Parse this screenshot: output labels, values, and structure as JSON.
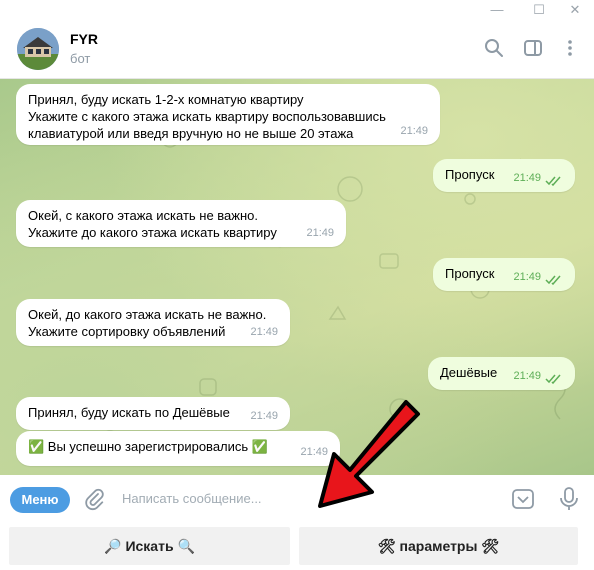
{
  "header": {
    "title": "FYR",
    "subtitle": "бот"
  },
  "messages": [
    {
      "side": "in",
      "text1": "Принял, буду искать 1-2-х комнатую квартиру",
      "text2": "Укажите с какого этажа искать квартиру воспользовавшись",
      "text3": "клавиатурой или введя вручную но не выше 20 этажа",
      "time": "21:49"
    },
    {
      "side": "out",
      "text": "Пропуск",
      "time": "21:49"
    },
    {
      "side": "in",
      "text1": "Окей, с какого этажа искать не важно.",
      "text2": "Укажите до какого этажа искать квартиру",
      "time": "21:49"
    },
    {
      "side": "out",
      "text": "Пропуск",
      "time": "21:49"
    },
    {
      "side": "in",
      "text1": "Окей, до какого этажа искать не важно.",
      "text2": "Укажите сортировку объявлений",
      "time": "21:49"
    },
    {
      "side": "out",
      "text": "Дешёвые",
      "time": "21:49"
    },
    {
      "side": "in",
      "text": "Принял, буду искать по Дешёвые",
      "time": "21:49"
    },
    {
      "side": "in",
      "text": "✅ Вы успешно зарегистрировались ✅",
      "time": "21:49"
    }
  ],
  "composer": {
    "menu_label": "Меню",
    "placeholder": "Написать сообщение..."
  },
  "keyboard": {
    "buttons": [
      "🔎 Искать 🔍",
      "🛠 параметры 🛠"
    ]
  },
  "colors": {
    "accent": "#4c9ce2",
    "outgoing_bubble": "#effdde",
    "check": "#5dae56",
    "arrow": "#e8151b"
  },
  "icons": [
    "minimize-icon",
    "maximize-icon",
    "close-icon",
    "search-icon",
    "sidebar-icon",
    "more-icon",
    "attach-icon",
    "keyboard-icon",
    "microphone-icon",
    "double-check-icon",
    "red-arrow"
  ]
}
